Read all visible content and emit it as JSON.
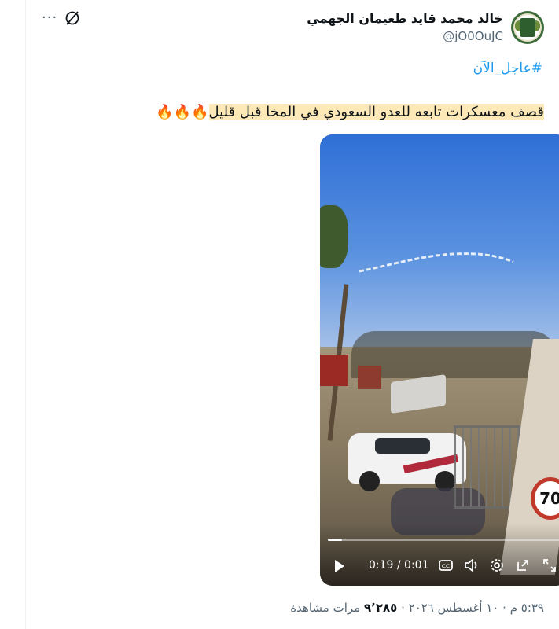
{
  "author": {
    "name": "خالد محمد قايد طعيمان الجهمي",
    "handle": "@jO0OuJC"
  },
  "header": {
    "more_label": "···"
  },
  "tweet": {
    "hashtag": "#عاجل_الآن",
    "text": "قصف معسكرات تابعه للعدو السعودي في المخا قبل قليل",
    "emojis": "🔥🔥🔥"
  },
  "video": {
    "time_display": "0:19 / 0:01",
    "progress_fraction": 0.06,
    "sign_text": "70",
    "icons": [
      "play-icon",
      "captions-icon",
      "volume-icon",
      "settings-icon",
      "popout-icon",
      "fullscreen-icon"
    ]
  },
  "meta": {
    "time": "٥:٣٩ م",
    "date": "١٠ أغسطس ٢٠٢٦",
    "views_count": "٩٬٢٨٥",
    "views_label": "مرات مشاهدة",
    "sep": "·"
  },
  "colors": {
    "link": "#1d9bf0",
    "highlight": "#fde9b8",
    "secondary_text": "#536471"
  }
}
